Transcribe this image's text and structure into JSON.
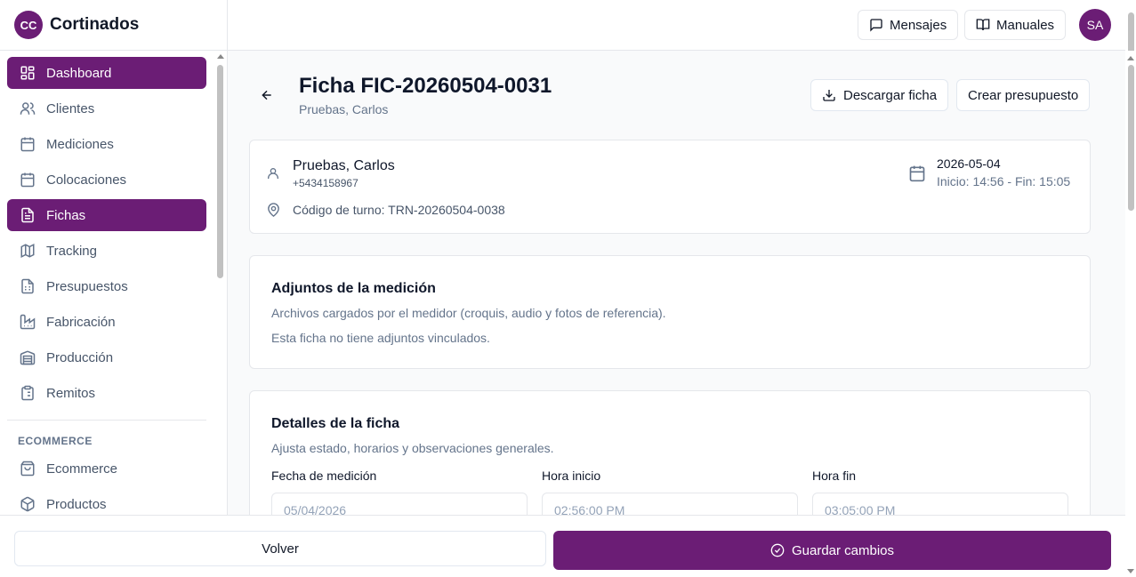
{
  "brand": {
    "logo_text": "CC",
    "name": "Cortinados"
  },
  "sidebar": {
    "items": [
      {
        "label": "Dashboard",
        "icon": "dashboard-icon",
        "active": true
      },
      {
        "label": "Clientes",
        "icon": "users-icon",
        "active": false
      },
      {
        "label": "Mediciones",
        "icon": "calendar-icon",
        "active": false
      },
      {
        "label": "Colocaciones",
        "icon": "calendar-icon",
        "active": false
      },
      {
        "label": "Fichas",
        "icon": "file-text-icon",
        "active": true
      },
      {
        "label": "Tracking",
        "icon": "map-icon",
        "active": false
      },
      {
        "label": "Presupuestos",
        "icon": "file-spreadsheet-icon",
        "active": false
      },
      {
        "label": "Fabricación",
        "icon": "factory-icon",
        "active": false
      },
      {
        "label": "Producción",
        "icon": "warehouse-icon",
        "active": false
      },
      {
        "label": "Remitos",
        "icon": "clipboard-list-icon",
        "active": false
      }
    ],
    "section_label": "ECOMMERCE",
    "section_items": [
      {
        "label": "Ecommerce",
        "icon": "shopping-bag-icon"
      },
      {
        "label": "Productos",
        "icon": "package-icon"
      }
    ]
  },
  "header": {
    "messages_label": "Mensajes",
    "manuals_label": "Manuales",
    "avatar_initials": "SA"
  },
  "page": {
    "title": "Ficha FIC-20260504-0031",
    "subtitle": "Pruebas, Carlos",
    "download_label": "Descargar ficha",
    "create_quote_label": "Crear presupuesto"
  },
  "summary": {
    "client_name": "Pruebas, Carlos",
    "client_phone": "+5434158967",
    "turn_code": "Código de turno: TRN-20260504-0038",
    "date": "2026-05-04",
    "time_range": "Inicio: 14:56 - Fin: 15:05"
  },
  "attachments": {
    "title": "Adjuntos de la medición",
    "description": "Archivos cargados por el medidor (croquis, audio y fotos de referencia).",
    "empty_text": "Esta ficha no tiene adjuntos vinculados."
  },
  "details": {
    "title": "Detalles de la ficha",
    "description": "Ajusta estado, horarios y observaciones generales.",
    "fields": [
      {
        "label": "Fecha de medición",
        "value": "05/04/2026"
      },
      {
        "label": "Hora inicio",
        "value": "02:56:00 PM"
      },
      {
        "label": "Hora fin",
        "value": "03:05:00 PM"
      }
    ]
  },
  "footer": {
    "back_label": "Volver",
    "save_label": "Guardar cambios"
  }
}
